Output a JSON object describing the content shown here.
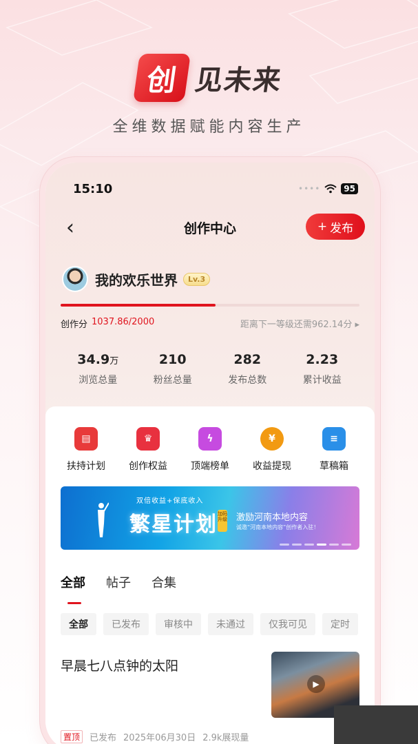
{
  "hero": {
    "logo_char": "创",
    "brand_text": "见未来",
    "subtitle": "全维数据赋能内容生产"
  },
  "status_bar": {
    "time": "15:10",
    "battery": "95"
  },
  "nav": {
    "title": "创作中心",
    "publish_label": "发布"
  },
  "profile": {
    "username": "我的欢乐世界",
    "level": "Lv.3"
  },
  "score": {
    "label": "创作分",
    "value": "1037.86/2000",
    "progress": 0.519,
    "next_level": "距离下一等级还需962.14分"
  },
  "stats": [
    {
      "value": "34.9",
      "unit": "万",
      "label": "浏览总量"
    },
    {
      "value": "210",
      "unit": "",
      "label": "粉丝总量"
    },
    {
      "value": "282",
      "unit": "",
      "label": "发布总数"
    },
    {
      "value": "2.23",
      "unit": "",
      "label": "累计收益"
    }
  ],
  "tools": [
    {
      "label": "扶持计划",
      "icon": "calendar-icon",
      "color": "#e83a3a"
    },
    {
      "label": "创作权益",
      "icon": "crown-icon",
      "color": "#e8313f"
    },
    {
      "label": "顶端榜单",
      "icon": "lightning-badge-icon",
      "color": "#c64be0"
    },
    {
      "label": "收益提现",
      "icon": "yen-coin-icon",
      "color": "#f29a12"
    },
    {
      "label": "草稿箱",
      "icon": "document-icon",
      "color": "#2a8fe8"
    }
  ],
  "banner": {
    "tag": "双倍收益+保底收入",
    "title": "繁星计划",
    "badge": "加码升级",
    "right_title": "激励河南本地内容",
    "right_sub": "诚邀“河南本地内容”创作者入驻！"
  },
  "tabs": [
    "全部",
    "帖子",
    "合集"
  ],
  "filters": [
    "全部",
    "已发布",
    "审核中",
    "未通过",
    "仅我可见",
    "定时"
  ],
  "post": {
    "title": "早晨七八点钟的太阳",
    "pin": "置顶",
    "status": "已发布",
    "date": "2025年06月30日",
    "views": "2.9k展现量"
  }
}
